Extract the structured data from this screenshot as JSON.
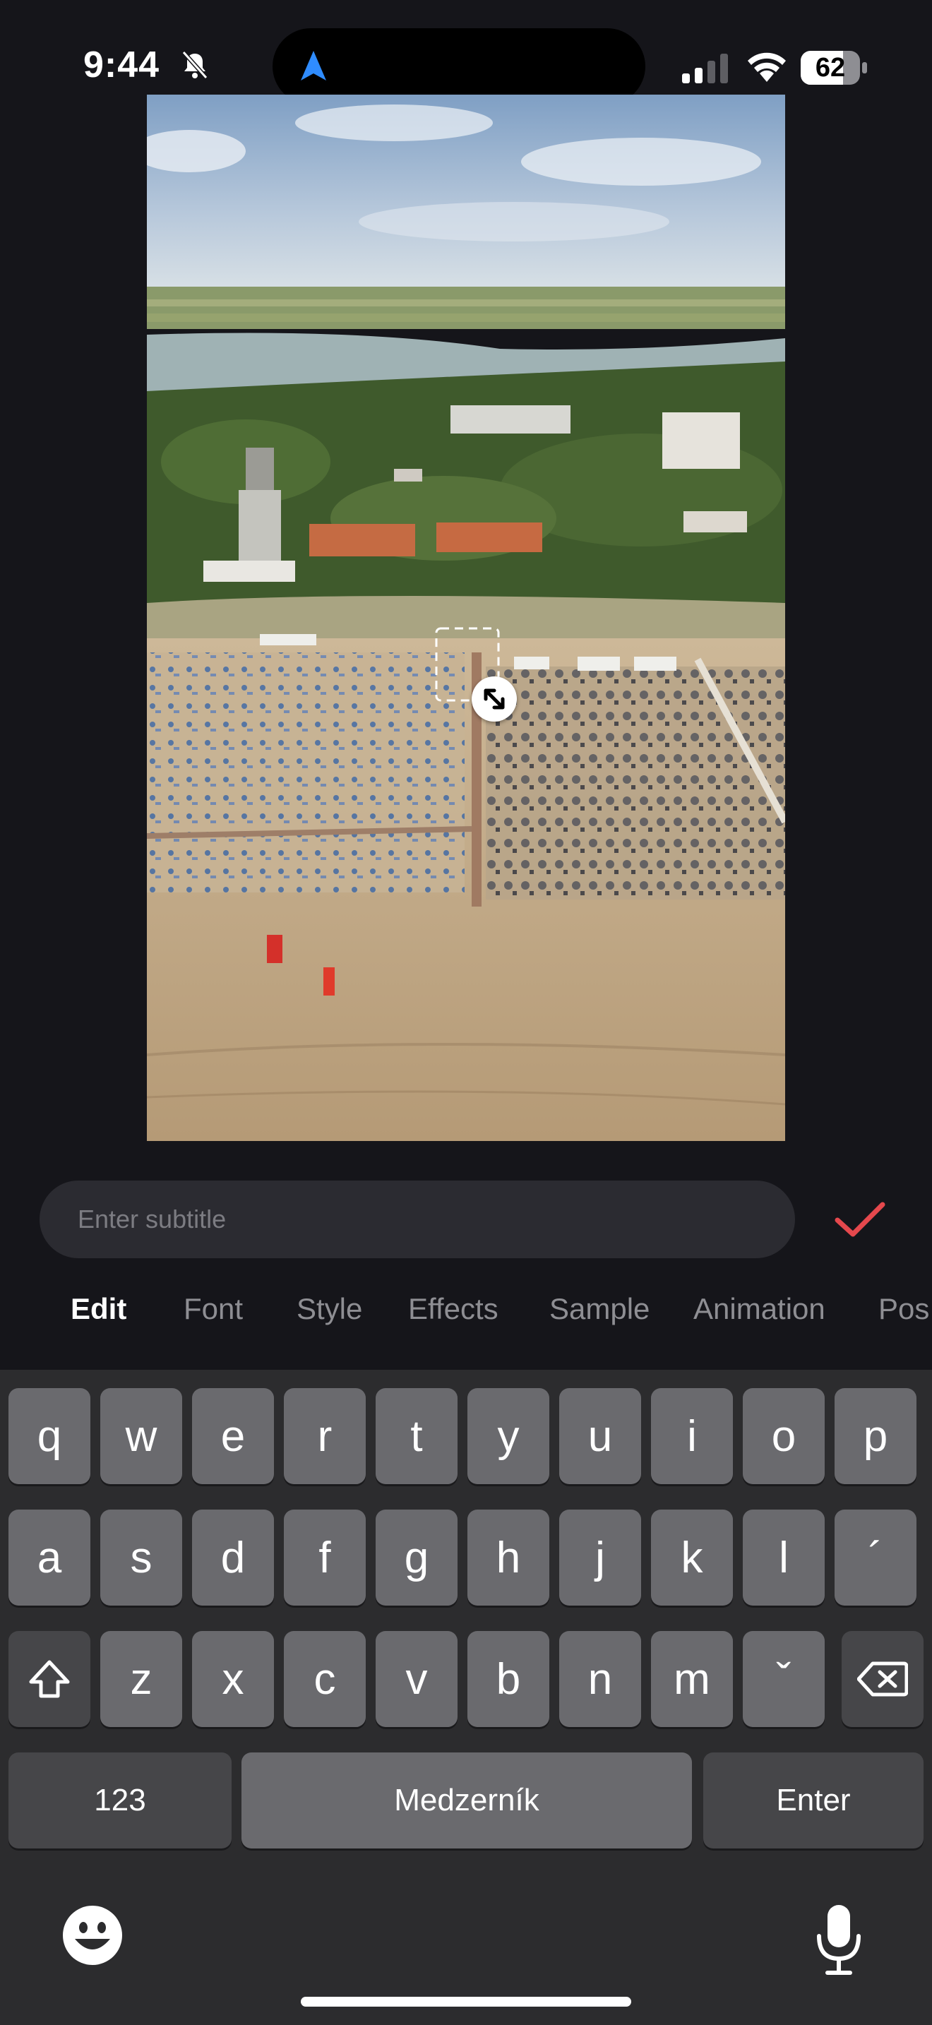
{
  "status_bar": {
    "time": "9:44",
    "battery_level": "62",
    "icons": [
      "bell-muted-icon",
      "location-arrow-icon",
      "cellular-signal-icon",
      "wifi-icon",
      "battery-icon"
    ]
  },
  "subtitle": {
    "placeholder": "Enter subtitle",
    "value": ""
  },
  "tabs": [
    {
      "label": "Edit",
      "active": true
    },
    {
      "label": "Font",
      "active": false
    },
    {
      "label": "Style",
      "active": false
    },
    {
      "label": "Effects",
      "active": false
    },
    {
      "label": "Sample",
      "active": false
    },
    {
      "label": "Animation",
      "active": false
    },
    {
      "label": "Pos",
      "active": false
    }
  ],
  "keyboard": {
    "row1": [
      "q",
      "w",
      "e",
      "r",
      "t",
      "y",
      "u",
      "i",
      "o",
      "p"
    ],
    "row2": [
      "a",
      "s",
      "d",
      "f",
      "g",
      "h",
      "j",
      "k",
      "l",
      "´"
    ],
    "row3": [
      "z",
      "x",
      "c",
      "v",
      "b",
      "n",
      "m",
      "ˇ"
    ],
    "numbers_label": "123",
    "space_label": "Medzerník",
    "enter_label": "Enter"
  },
  "colors": {
    "accent": "#e5484d",
    "background": "#15151a",
    "keyboard": "#2c2c2e",
    "key": "#6a6a6e",
    "key_dark": "#464649",
    "location": "#2f8cff"
  }
}
